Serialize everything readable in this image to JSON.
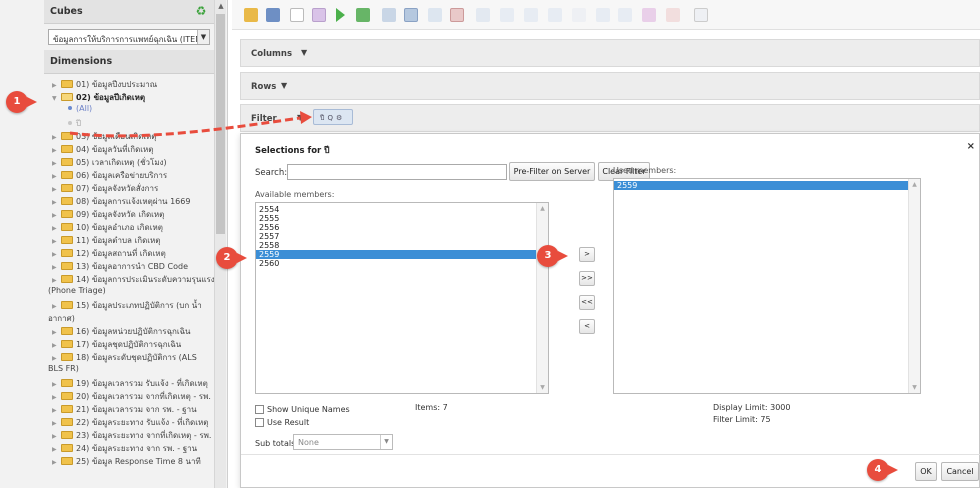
{
  "cubes": {
    "title": "Cubes",
    "selected_cube": "ข้อมูลการให้บริการการแพทย์ฉุกเฉิน (ITEM"
  },
  "dimensions": {
    "title": "Dimensions",
    "items": [
      {
        "label": "01) ข้อมูลปีงบประมาณ",
        "type": "folder"
      },
      {
        "label": "02) ข้อมูลปีเกิดเหตุ",
        "type": "folder-open"
      },
      {
        "label": "(All)",
        "type": "member"
      },
      {
        "label": "ปี",
        "type": "member-gray"
      },
      {
        "label": "03) ข้อมูลเดือนเกิดเหตุ",
        "type": "folder"
      },
      {
        "label": "04) ข้อมูลวันที่เกิดเหตุ",
        "type": "folder"
      },
      {
        "label": "05) เวลาเกิดเหตุ (ชั่วโมง)",
        "type": "folder"
      },
      {
        "label": "06) ข้อมูลเครือข่ายบริการ",
        "type": "folder"
      },
      {
        "label": "07) ข้อมูลจังหวัดสั่งการ",
        "type": "folder"
      },
      {
        "label": "08) ข้อมูลการแจ้งเหตุผ่าน 1669",
        "type": "folder"
      },
      {
        "label": "09) ข้อมูลจังหวัด เกิดเหตุ",
        "type": "folder"
      },
      {
        "label": "10) ข้อมูลอำเภอ เกิดเหตุ",
        "type": "folder"
      },
      {
        "label": "11) ข้อมูลตำบล เกิดเหตุ",
        "type": "folder"
      },
      {
        "label": "12) ข้อมูลสถานที่ เกิดเหตุ",
        "type": "folder"
      },
      {
        "label": "13) ข้อมูลอาการนำ CBD Code",
        "type": "folder"
      },
      {
        "label": "14) ข้อมูลการประเมินระดับความรุนแรง",
        "type": "folder"
      },
      {
        "label": "(Phone Triage)",
        "type": "wrap"
      },
      {
        "label": "15) ข้อมูลประเภทปฏิบัติการ (บก น้ำ",
        "type": "folder"
      },
      {
        "label": "อากาศ)",
        "type": "wrap"
      },
      {
        "label": "16) ข้อมูลหน่วยปฏิบัติการฉุกเฉิน",
        "type": "folder"
      },
      {
        "label": "17) ข้อมูลชุดปฏิบัติการฉุกเฉิน",
        "type": "folder"
      },
      {
        "label": "18) ข้อมูลระดับชุดปฏิบัติการ (ALS",
        "type": "folder"
      },
      {
        "label": "BLS FR)",
        "type": "wrap"
      },
      {
        "label": "19) ข้อมูลเวลารวม รับแจ้ง - ที่เกิดเหตุ",
        "type": "folder"
      },
      {
        "label": "20) ข้อมูลเวลารวม จากที่เกิดเหตุ - รพ.",
        "type": "folder"
      },
      {
        "label": "21) ข้อมูลเวลารวม จาก รพ. - ฐาน",
        "type": "folder"
      },
      {
        "label": "22) ข้อมูลระยะทาง รับแจ้ง - ที่เกิดเหตุ",
        "type": "folder"
      },
      {
        "label": "23) ข้อมูลระยะทาง จากที่เกิดเหตุ - รพ.",
        "type": "folder"
      },
      {
        "label": "24) ข้อมูลระยะทาง จาก รพ. - ฐาน",
        "type": "folder"
      },
      {
        "label": "25) ข้อมูล Response Time 8 นาที",
        "type": "folder"
      }
    ]
  },
  "zones": {
    "columns": "Columns",
    "rows": "Rows",
    "filter": "Filter"
  },
  "dialog": {
    "title": "Selections for ปี",
    "close": "×",
    "search_label": "Search:",
    "search_value": "",
    "prefilter_button": "Pre-Filter on Server",
    "clear_button": "Clear Filter",
    "available_label": "Available members:",
    "used_label": "Used members:",
    "available": [
      "2554",
      "2555",
      "2556",
      "2557",
      "2558",
      "2559",
      "2560"
    ],
    "available_selected": "2559",
    "used": [
      "2559"
    ],
    "move_buttons": [
      ">",
      ">>",
      "<<",
      "<"
    ],
    "show_unique_names": "Show Unique Names",
    "use_result": "Use Result",
    "items_count": "Items: 7",
    "display_limit": "Display Limit: 3000",
    "filter_limit": "Filter Limit: 75",
    "subtotals_label": "Sub totals",
    "subtotals_value": "None",
    "ok": "OK",
    "cancel": "Cancel"
  },
  "annotations": [
    "1",
    "2",
    "3",
    "4"
  ],
  "colors": {
    "badge": "#e84c3d",
    "selection": "#3b8ed6",
    "folder": "#f0c24b"
  }
}
